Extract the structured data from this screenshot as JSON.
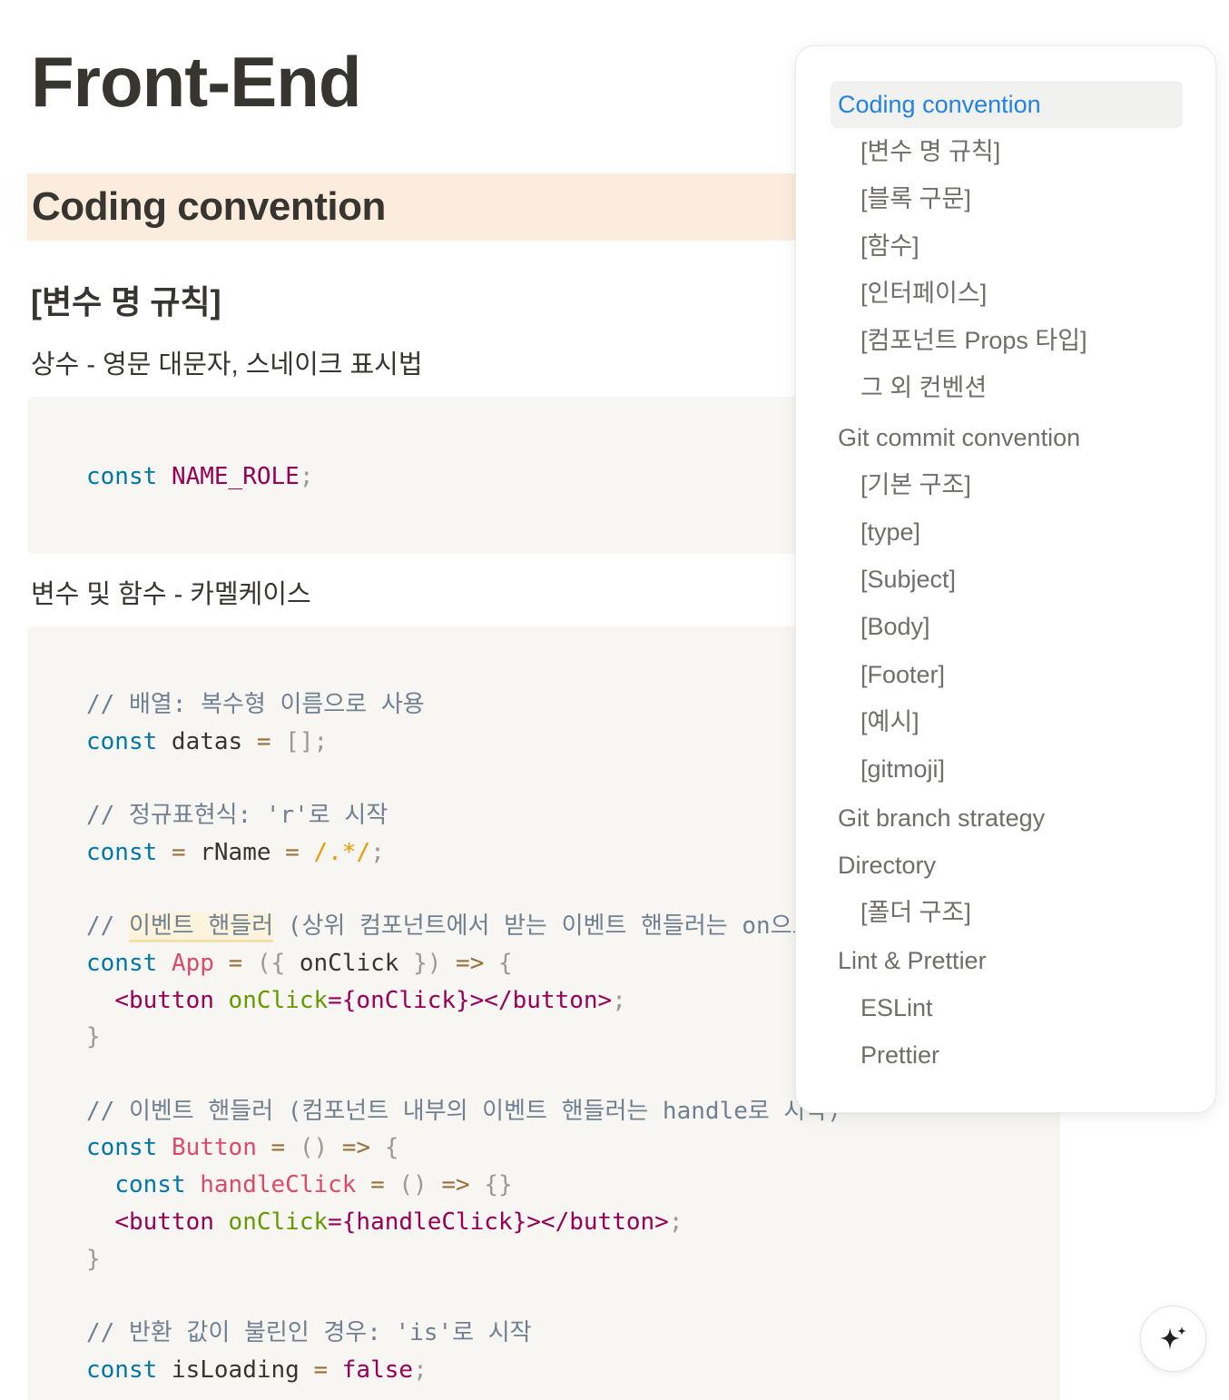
{
  "page": {
    "title": "Front-End"
  },
  "section": {
    "heading": "Coding convention"
  },
  "subsection": {
    "heading": "[변수 명 규칙]"
  },
  "paragraphs": {
    "constants": "상수 - 영문 대문자, 스네이크 표시법",
    "variables": "변수 및 함수 - 카멜케이스"
  },
  "code1": {
    "kw": "const",
    "name": "NAME_ROLE",
    "semi": ";"
  },
  "code2": {
    "c1": "// 배열: 복수형 이름으로 사용",
    "c2": "// 정규표현식: 'r'로 시작",
    "c3_pre": "// ",
    "c3_hl": "이벤트 핸들러",
    "c3_post": " (상위 컴포넌트에서 받는 이벤트 핸들러는 on으로 시작)",
    "c4": "// 이벤트 핸들러 (컴포넌트 내부의 이벤트 핸들러는 handle로 시작)",
    "c5": "// 반환 값이 불린인 경우: 'is'로 시작"
  },
  "toc": {
    "items": [
      {
        "label": "Coding convention",
        "level": 1,
        "active": true
      },
      {
        "label": "[변수 명 규칙]",
        "level": 2
      },
      {
        "label": "[블록 구문]",
        "level": 2
      },
      {
        "label": "[함수]",
        "level": 2
      },
      {
        "label": "[인터페이스]",
        "level": 2
      },
      {
        "label": "[컴포넌트 Props 타입]",
        "level": 2
      },
      {
        "label": "그 외 컨벤션",
        "level": 2
      },
      {
        "label": "Git commit convention",
        "level": 1
      },
      {
        "label": "[기본 구조]",
        "level": 2
      },
      {
        "label": "[type]",
        "level": 2
      },
      {
        "label": "[Subject]",
        "level": 2
      },
      {
        "label": "[Body]",
        "level": 2
      },
      {
        "label": "[Footer]",
        "level": 2
      },
      {
        "label": "[예시]",
        "level": 2
      },
      {
        "label": "[gitmoji]",
        "level": 2
      },
      {
        "label": "Git branch strategy",
        "level": 1
      },
      {
        "label": "Directory",
        "level": 1
      },
      {
        "label": "[폴더 구조]",
        "level": 2
      },
      {
        "label": "Lint & Prettier",
        "level": 1
      },
      {
        "label": "ESLint",
        "level": 2
      },
      {
        "label": "Prettier",
        "level": 2
      }
    ]
  },
  "ai_button": {
    "icon": "sparkle-icon"
  },
  "colors": {
    "heading_bg": "#fbecdd",
    "code_bg": "#f7f6f3",
    "toc_active": "#2383e2",
    "keyword": "#0077aa",
    "comment": "#708090"
  }
}
